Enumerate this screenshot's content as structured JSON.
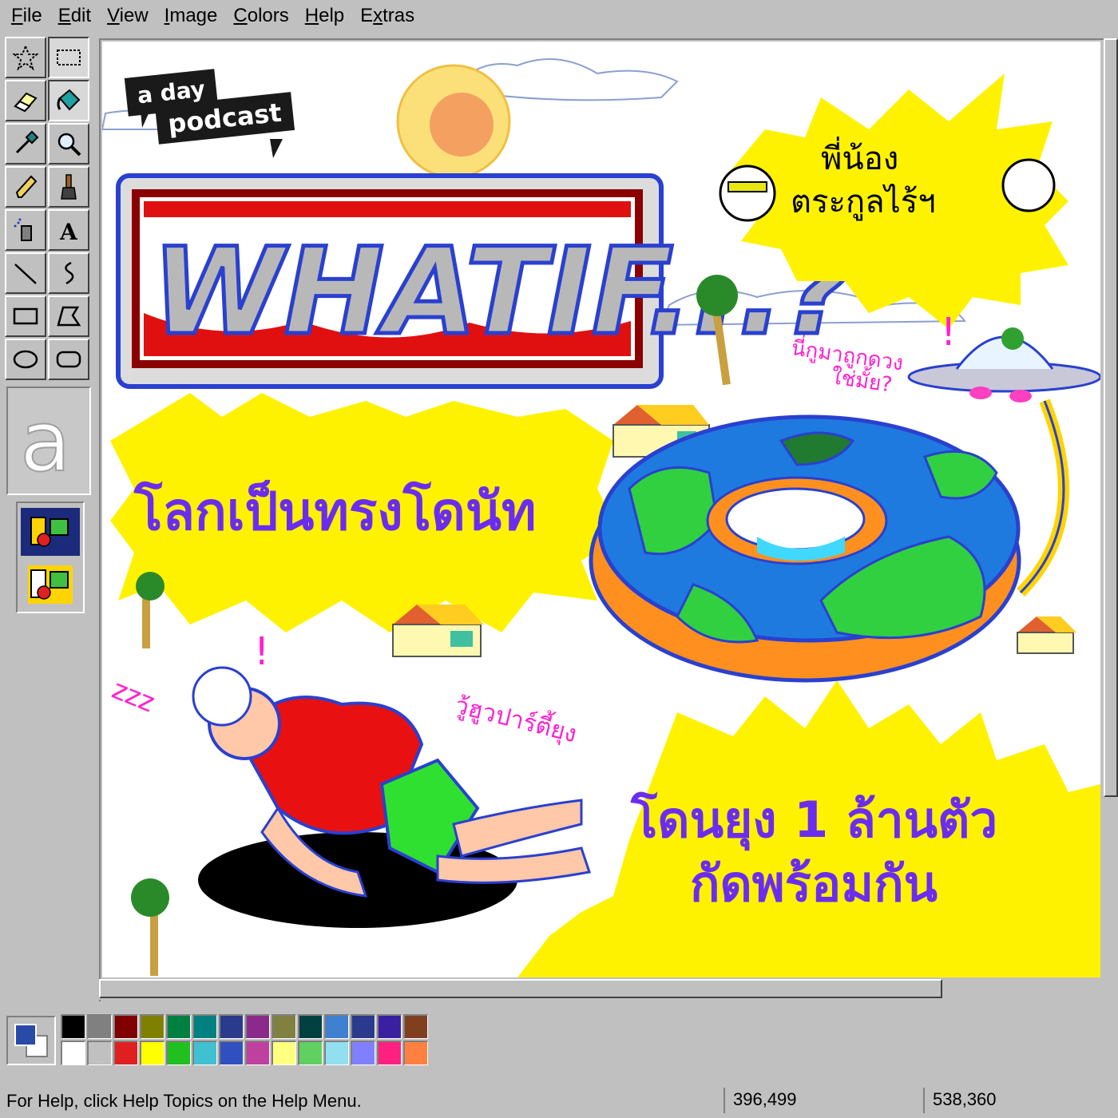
{
  "menu": [
    {
      "label": "File",
      "mnemonic": "F",
      "rest": "ile"
    },
    {
      "label": "Edit",
      "mnemonic": "E",
      "rest": "dit"
    },
    {
      "label": "View",
      "mnemonic": "V",
      "rest": "iew"
    },
    {
      "label": "Image",
      "mnemonic": "I",
      "rest": "mage"
    },
    {
      "label": "Colors",
      "mnemonic": "C",
      "rest": "olors"
    },
    {
      "label": "Help",
      "mnemonic": "H",
      "rest": "elp"
    },
    {
      "label": "Extras",
      "mnemonic": "x",
      "rest": "tras"
    }
  ],
  "tools": [
    "free-select",
    "rect-select",
    "eraser",
    "fill",
    "color-picker",
    "magnifier",
    "pencil",
    "brush",
    "airbrush",
    "text",
    "line",
    "curve",
    "rectangle",
    "polygon",
    "ellipse",
    "rounded-rectangle"
  ],
  "font_preview_glyph": "a",
  "artwork": {
    "logo_line1": "a day",
    "logo_line2": "podcast",
    "title": "WHATIF...?",
    "headline_donut": "โลกเป็นทรงโดนัท",
    "headline_mosquito_1": "โดนยุง 1 ล้านตัว",
    "headline_mosquito_2": "กัดพร้อมกัน",
    "hosts_caption_1": "พี่น้อง",
    "hosts_caption_2": "ตระกูลไร้ฯ",
    "alien_caption_1": "นี่กูมาถูกดวง",
    "alien_caption_2": "ใช่มั้ย?",
    "mosquito_caption": "วู้ฮูวปาร์ตี้ยุง",
    "snore": "zzz"
  },
  "palette": {
    "primary": "#2a4aa8",
    "secondary": "#ffffff",
    "row1": [
      "#000000",
      "#808080",
      "#800000",
      "#808000",
      "#008040",
      "#008080",
      "#2a3a8c",
      "#8c2a8c",
      "#808040",
      "#004040",
      "#4080d0",
      "#2a3a8c",
      "#3a20a0",
      "#804020"
    ],
    "row2": [
      "#ffffff",
      "#c0c0c0",
      "#e02020",
      "#ffff00",
      "#20c020",
      "#40c0d0",
      "#3050c0",
      "#c040a0",
      "#ffff80",
      "#60d060",
      "#90e0f0",
      "#8080ff",
      "#ff2080",
      "#ff8040"
    ]
  },
  "status": {
    "help": "For Help, click Help Topics on the Help Menu.",
    "cursor_pos": "396,499",
    "canvas_size": "538,360"
  }
}
